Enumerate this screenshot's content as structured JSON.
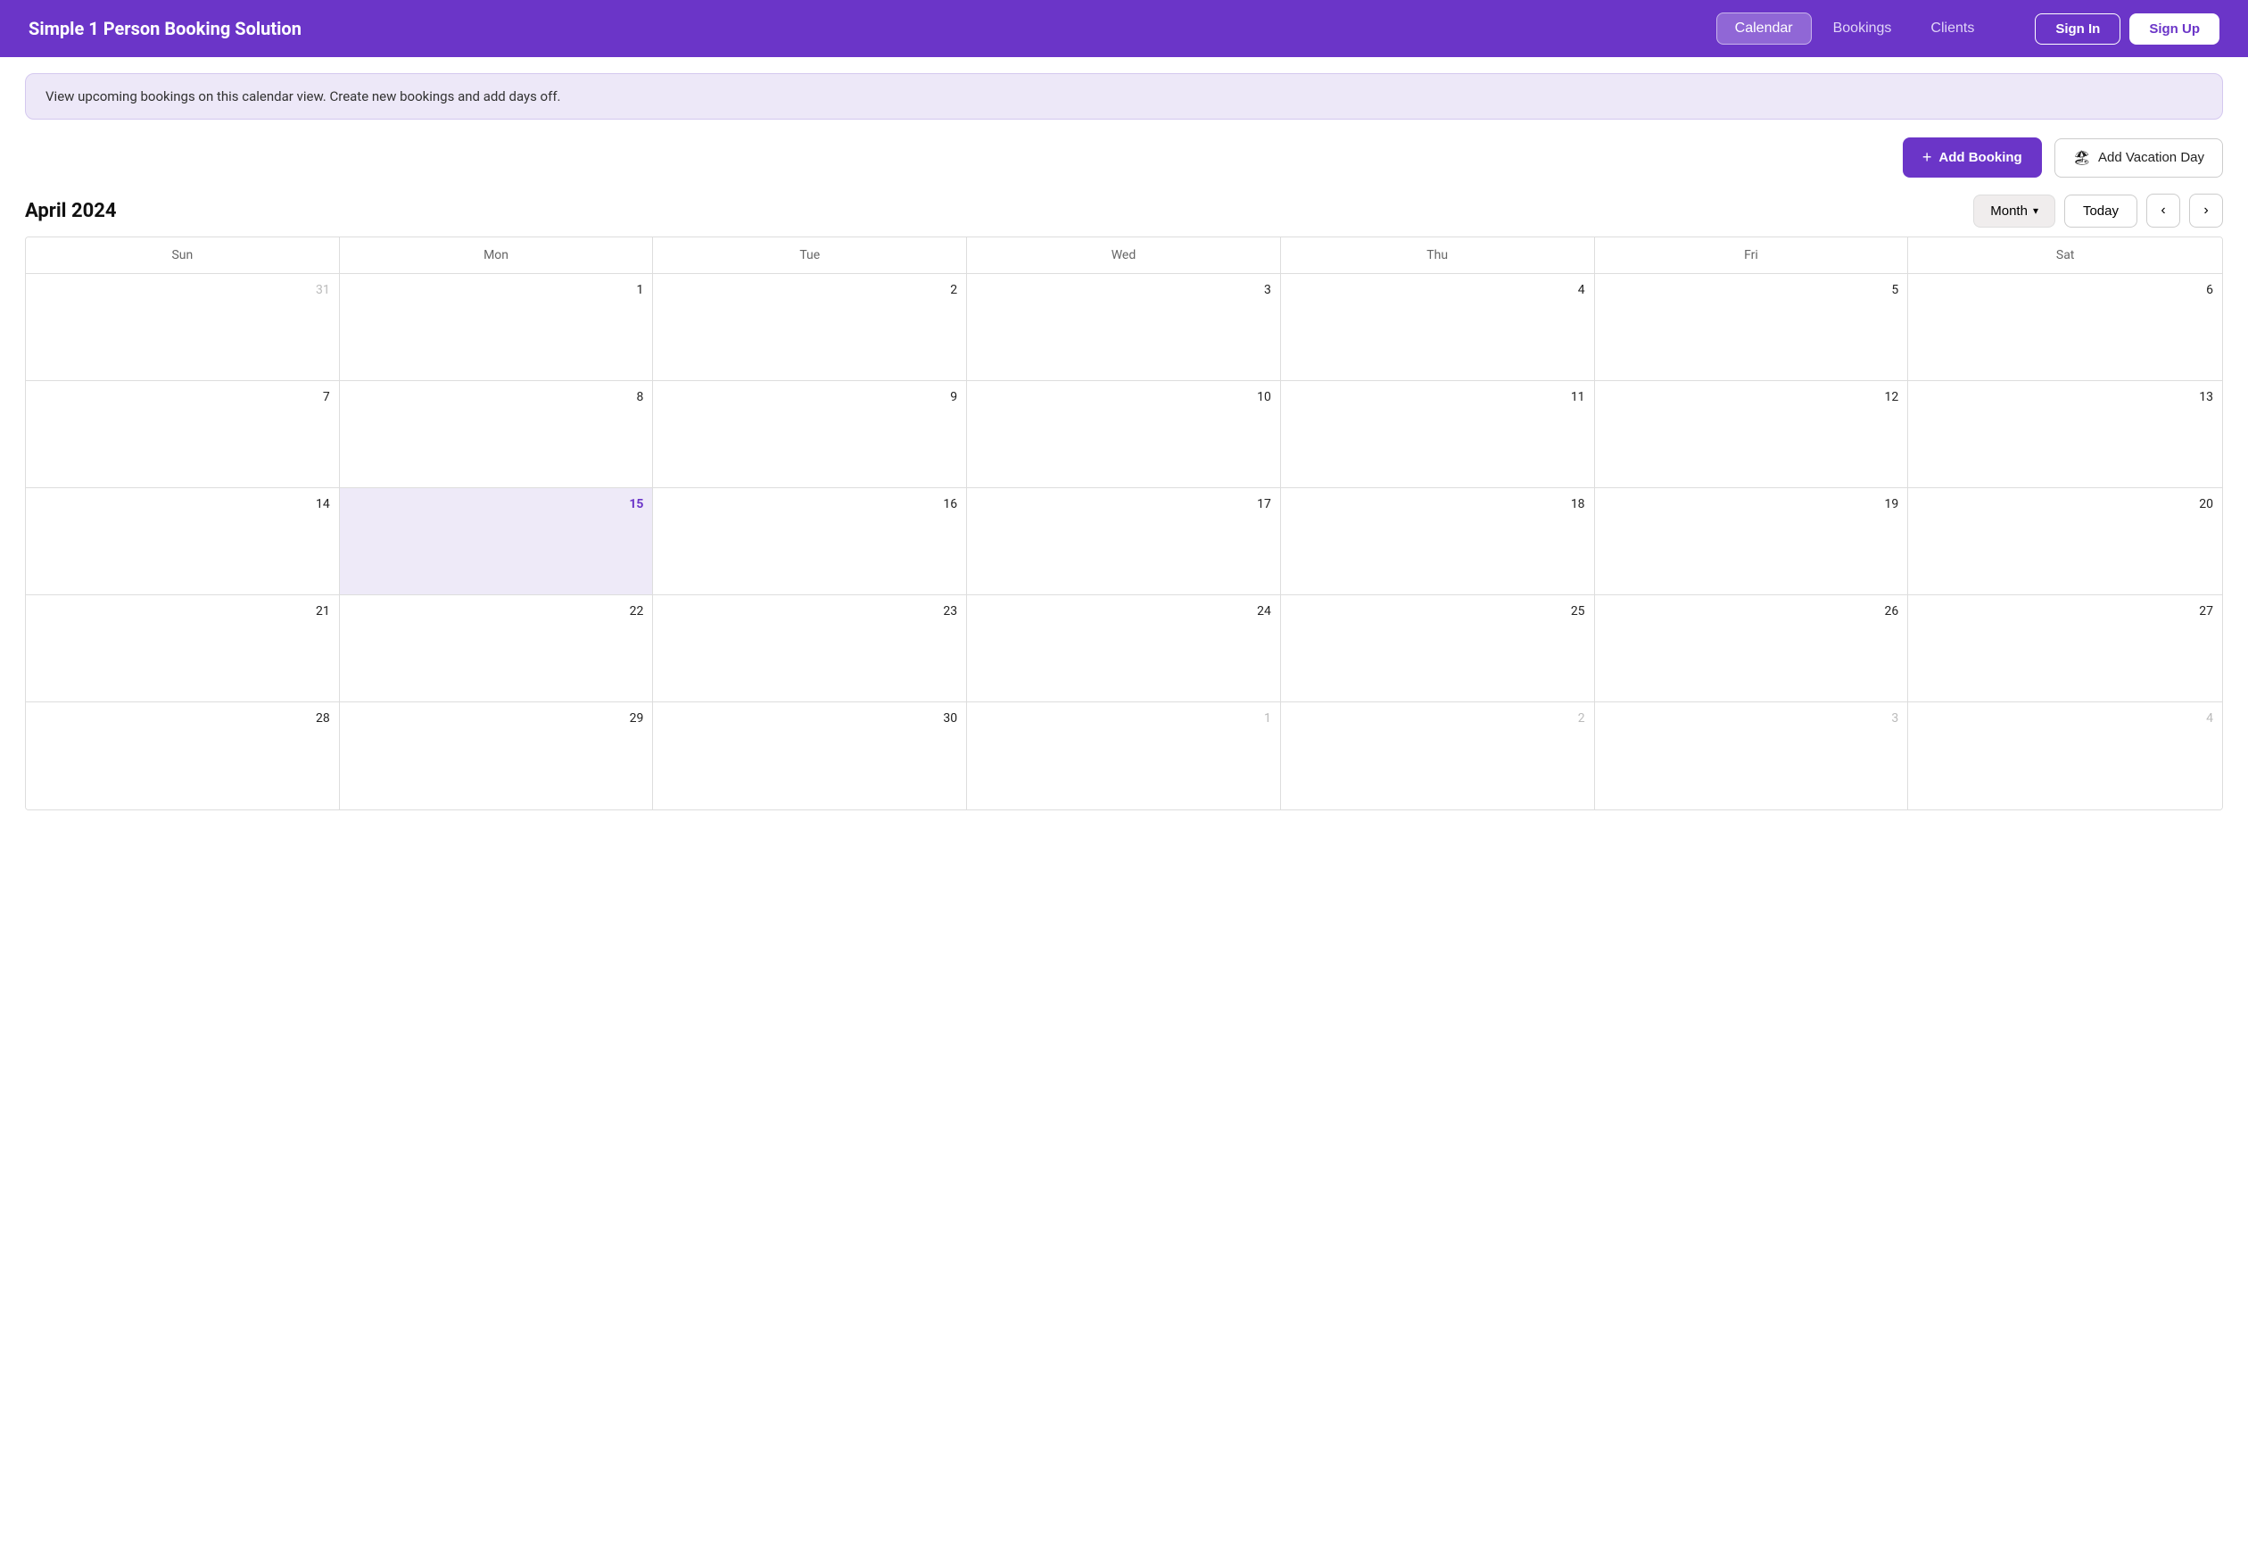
{
  "header": {
    "title": "Simple 1 Person Booking Solution",
    "nav": [
      {
        "label": "Calendar",
        "active": true
      },
      {
        "label": "Bookings",
        "active": false
      },
      {
        "label": "Clients",
        "active": false
      }
    ],
    "sign_in": "Sign In",
    "sign_up": "Sign Up"
  },
  "info_bar": {
    "text": "View upcoming bookings on this calendar view. Create new bookings and add days off."
  },
  "toolbar": {
    "add_booking": "Add Booking",
    "add_vacation": "Add Vacation Day"
  },
  "calendar": {
    "month_year": "April 2024",
    "view_label": "Month",
    "today_label": "Today",
    "days_of_week": [
      "Sun",
      "Mon",
      "Tue",
      "Wed",
      "Thu",
      "Fri",
      "Sat"
    ],
    "weeks": [
      [
        {
          "day": "31",
          "other": true
        },
        {
          "day": "1",
          "other": false
        },
        {
          "day": "2",
          "other": false
        },
        {
          "day": "3",
          "other": false
        },
        {
          "day": "4",
          "other": false
        },
        {
          "day": "5",
          "other": false
        },
        {
          "day": "6",
          "other": false
        }
      ],
      [
        {
          "day": "7",
          "other": false
        },
        {
          "day": "8",
          "other": false
        },
        {
          "day": "9",
          "other": false
        },
        {
          "day": "10",
          "other": false
        },
        {
          "day": "11",
          "other": false
        },
        {
          "day": "12",
          "other": false
        },
        {
          "day": "13",
          "other": false
        }
      ],
      [
        {
          "day": "14",
          "other": false
        },
        {
          "day": "15",
          "other": false,
          "today": true
        },
        {
          "day": "16",
          "other": false
        },
        {
          "day": "17",
          "other": false
        },
        {
          "day": "18",
          "other": false
        },
        {
          "day": "19",
          "other": false
        },
        {
          "day": "20",
          "other": false
        }
      ],
      [
        {
          "day": "21",
          "other": false
        },
        {
          "day": "22",
          "other": false
        },
        {
          "day": "23",
          "other": false
        },
        {
          "day": "24",
          "other": false
        },
        {
          "day": "25",
          "other": false
        },
        {
          "day": "26",
          "other": false
        },
        {
          "day": "27",
          "other": false
        }
      ],
      [
        {
          "day": "28",
          "other": false
        },
        {
          "day": "29",
          "other": false
        },
        {
          "day": "30",
          "other": false
        },
        {
          "day": "1",
          "other": true
        },
        {
          "day": "2",
          "other": true
        },
        {
          "day": "3",
          "other": true
        },
        {
          "day": "4",
          "other": true
        }
      ]
    ]
  }
}
